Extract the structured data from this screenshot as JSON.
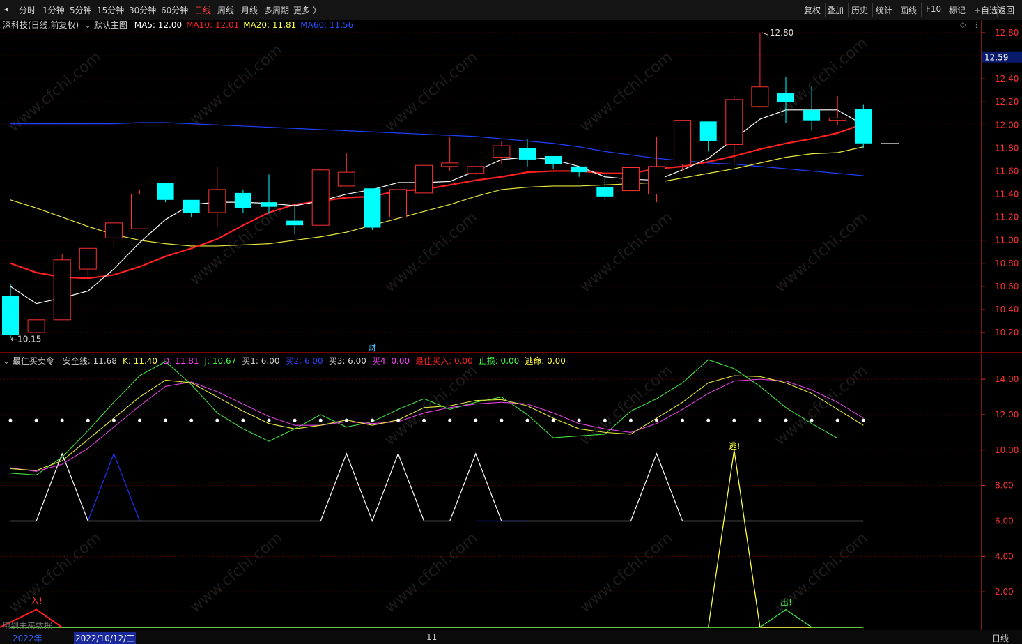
{
  "toolbar": {
    "periods": [
      "分时",
      "1分钟",
      "5分钟",
      "15分钟",
      "30分钟",
      "60分钟",
      "日线",
      "周线",
      "月线",
      "多周期",
      "更多 〉"
    ],
    "active_period": "日线",
    "right_tools": [
      "复权",
      "叠加",
      "历史",
      "统计",
      "画线",
      "F10",
      "标记",
      "+自选",
      "返回"
    ]
  },
  "main_panel": {
    "stock": "深科技(日线,前复权)",
    "template": "默认主图",
    "ma": [
      {
        "label": "MA5: 12.00",
        "color": "#ffffff"
      },
      {
        "label": "MA10: 12.01",
        "color": "#ff2020"
      },
      {
        "label": "MA20: 11.81",
        "color": "#ffff40"
      },
      {
        "label": "MA60: 11.56",
        "color": "#2050ff"
      }
    ],
    "price_axis": [
      "12.80",
      "12.60",
      "12.40",
      "12.20",
      "12.00",
      "11.80",
      "11.60",
      "11.40",
      "11.20",
      "11.00",
      "10.80",
      "10.60",
      "10.40",
      "10.20"
    ],
    "current_price": "12.59",
    "high_label": "12.80",
    "low_label": "10.15",
    "event_marker": "财"
  },
  "sub_panel": {
    "title": "最佳买卖令",
    "values": [
      {
        "label": "安全线: 11.68",
        "color": "#d0d0d0"
      },
      {
        "label": "K: 11.40",
        "color": "#ffff40"
      },
      {
        "label": "D: 11.81",
        "color": "#ff40ff"
      },
      {
        "label": "J: 10.67",
        "color": "#40ff40"
      },
      {
        "label": "买1: 6.00",
        "color": "#d0d0d0"
      },
      {
        "label": "买2: 6.00",
        "color": "#3040ff"
      },
      {
        "label": "买3: 6.00",
        "color": "#d0d0d0"
      },
      {
        "label": "买4: 0.00",
        "color": "#ff40ff"
      },
      {
        "label": "最佳买入: 0.00",
        "color": "#ff2020"
      },
      {
        "label": "止损: 0.00",
        "color": "#40ff40"
      },
      {
        "label": "逃命: 0.00",
        "color": "#ffff40"
      }
    ],
    "axis": [
      "14.00",
      "12.00",
      "10.00",
      "8.00",
      "6.00",
      "4.00",
      "2.00"
    ],
    "signal_in": "入!",
    "signal_escape": "逃!",
    "signal_out": "出!",
    "footnote": "用到未来数据"
  },
  "bottom": {
    "year": "2022年",
    "cursor_date": "2022/10/12/三",
    "month": "11",
    "period": "日线"
  },
  "watermark": "www.cfchi.com",
  "colors": {
    "up": "#ff3030",
    "down": "#00ffff",
    "grid": "#5a0000",
    "axis": "#ff3030"
  },
  "chart_data": {
    "type": "candlestick",
    "price_range": [
      10.1,
      12.9
    ],
    "candles": [
      {
        "o": 10.52,
        "h": 10.62,
        "l": 10.15,
        "c": 10.18
      },
      {
        "o": 10.2,
        "h": 10.32,
        "l": 10.2,
        "c": 10.31
      },
      {
        "o": 10.31,
        "h": 10.88,
        "l": 10.31,
        "c": 10.83
      },
      {
        "o": 10.75,
        "h": 10.93,
        "l": 10.68,
        "c": 10.93
      },
      {
        "o": 11.02,
        "h": 11.16,
        "l": 10.94,
        "c": 11.15
      },
      {
        "o": 11.1,
        "h": 11.44,
        "l": 11.1,
        "c": 11.4
      },
      {
        "o": 11.5,
        "h": 11.5,
        "l": 11.33,
        "c": 11.35
      },
      {
        "o": 11.35,
        "h": 11.35,
        "l": 11.2,
        "c": 11.24
      },
      {
        "o": 11.24,
        "h": 11.64,
        "l": 11.12,
        "c": 11.44
      },
      {
        "o": 11.41,
        "h": 11.44,
        "l": 11.24,
        "c": 11.28
      },
      {
        "o": 11.33,
        "h": 11.57,
        "l": 11.23,
        "c": 11.29
      },
      {
        "o": 11.17,
        "h": 11.32,
        "l": 11.05,
        "c": 11.13
      },
      {
        "o": 11.13,
        "h": 11.62,
        "l": 11.13,
        "c": 11.61
      },
      {
        "o": 11.47,
        "h": 11.76,
        "l": 11.47,
        "c": 11.59
      },
      {
        "o": 11.45,
        "h": 11.45,
        "l": 11.09,
        "c": 11.11
      },
      {
        "o": 11.2,
        "h": 11.62,
        "l": 11.14,
        "c": 11.44
      },
      {
        "o": 11.41,
        "h": 11.66,
        "l": 11.41,
        "c": 11.65
      },
      {
        "o": 11.64,
        "h": 11.9,
        "l": 11.6,
        "c": 11.67
      },
      {
        "o": 11.58,
        "h": 11.64,
        "l": 11.57,
        "c": 11.64
      },
      {
        "o": 11.72,
        "h": 11.86,
        "l": 11.66,
        "c": 11.82
      },
      {
        "o": 11.8,
        "h": 11.88,
        "l": 11.64,
        "c": 11.7
      },
      {
        "o": 11.73,
        "h": 11.73,
        "l": 11.62,
        "c": 11.66
      },
      {
        "o": 11.64,
        "h": 11.64,
        "l": 11.55,
        "c": 11.59
      },
      {
        "o": 11.46,
        "h": 11.58,
        "l": 11.35,
        "c": 11.38
      },
      {
        "o": 11.43,
        "h": 11.63,
        "l": 11.43,
        "c": 11.63
      },
      {
        "o": 11.4,
        "h": 11.9,
        "l": 11.33,
        "c": 11.64
      },
      {
        "o": 11.66,
        "h": 12.04,
        "l": 11.6,
        "c": 12.04
      },
      {
        "o": 12.03,
        "h": 12.03,
        "l": 11.77,
        "c": 11.86
      },
      {
        "o": 11.83,
        "h": 12.25,
        "l": 11.67,
        "c": 12.22
      },
      {
        "o": 12.16,
        "h": 12.8,
        "l": 12.15,
        "c": 12.33
      },
      {
        "o": 12.28,
        "h": 12.42,
        "l": 12.02,
        "c": 12.2
      },
      {
        "o": 12.13,
        "h": 12.34,
        "l": 11.95,
        "c": 12.04
      },
      {
        "o": 12.04,
        "h": 12.25,
        "l": 12.0,
        "c": 12.06
      },
      {
        "o": 12.14,
        "h": 12.18,
        "l": 11.8,
        "c": 11.84
      }
    ],
    "ma5": [
      10.6,
      10.45,
      10.5,
      10.56,
      10.75,
      10.98,
      11.18,
      11.31,
      11.33,
      11.33,
      11.32,
      11.3,
      11.34,
      11.4,
      11.44,
      11.5,
      11.5,
      11.51,
      11.6,
      11.7,
      11.72,
      11.7,
      11.64,
      11.55,
      11.53,
      11.52,
      11.61,
      11.71,
      11.88,
      12.05,
      12.13,
      12.13,
      12.13,
      12.0
    ],
    "ma10": [
      10.8,
      10.72,
      10.68,
      10.67,
      10.7,
      10.77,
      10.86,
      10.93,
      11.01,
      11.13,
      11.24,
      11.31,
      11.34,
      11.37,
      11.38,
      11.43,
      11.44,
      11.48,
      11.52,
      11.55,
      11.59,
      11.6,
      11.6,
      11.58,
      11.58,
      11.62,
      11.64,
      11.68,
      11.73,
      11.79,
      11.84,
      11.88,
      11.93,
      12.01
    ],
    "ma20": [
      11.35,
      11.28,
      11.2,
      11.12,
      11.05,
      11.0,
      10.97,
      10.95,
      10.95,
      10.96,
      10.97,
      11.0,
      11.03,
      11.07,
      11.13,
      11.19,
      11.25,
      11.31,
      11.38,
      11.44,
      11.46,
      11.47,
      11.47,
      11.48,
      11.49,
      11.5,
      11.54,
      11.58,
      11.62,
      11.67,
      11.72,
      11.75,
      11.76,
      11.81
    ],
    "ma60": [
      12.01,
      12.01,
      12.01,
      12.01,
      12.01,
      12.02,
      12.02,
      12.01,
      12.0,
      11.99,
      11.98,
      11.97,
      11.96,
      11.95,
      11.94,
      11.93,
      11.92,
      11.91,
      11.9,
      11.88,
      11.86,
      11.84,
      11.81,
      11.77,
      11.74,
      11.71,
      11.69,
      11.67,
      11.66,
      11.64,
      11.62,
      11.6,
      11.58,
      11.56
    ],
    "sub_range": [
      0,
      15.5
    ],
    "safety_line": 11.68,
    "k": [
      8.95,
      8.85,
      9.4,
      10.6,
      11.8,
      13.0,
      13.95,
      13.8,
      13.0,
      12.2,
      11.5,
      11.2,
      11.4,
      11.7,
      11.4,
      11.7,
      12.4,
      12.5,
      12.8,
      12.85,
      12.5,
      11.8,
      11.2,
      11.0,
      10.9,
      11.8,
      12.7,
      13.8,
      14.2,
      14.15,
      13.8,
      13.2,
      12.3,
      11.4
    ],
    "d": [
      9.0,
      8.8,
      9.2,
      10.1,
      11.3,
      12.5,
      13.6,
      13.85,
      13.3,
      12.6,
      11.9,
      11.4,
      11.4,
      11.6,
      11.5,
      11.6,
      12.1,
      12.4,
      12.6,
      12.7,
      12.6,
      12.1,
      11.5,
      11.2,
      11.0,
      11.5,
      12.3,
      13.2,
      13.9,
      14.0,
      13.9,
      13.4,
      12.7,
      11.81
    ],
    "j": [
      8.7,
      8.6,
      9.6,
      11.1,
      12.7,
      14.2,
      15.0,
      13.7,
      12.1,
      11.2,
      10.5,
      11.2,
      12.0,
      11.3,
      11.6,
      12.3,
      12.9,
      12.3,
      12.7,
      13.0,
      12.0,
      10.7,
      10.8,
      10.9,
      12.2,
      12.9,
      13.8,
      15.1,
      14.6,
      13.6,
      12.4,
      11.5,
      10.67
    ],
    "buy1": [
      6,
      6,
      9.8,
      6,
      6,
      6,
      6,
      6,
      6,
      6,
      6,
      6,
      6,
      9.8,
      6,
      9.8,
      6,
      6,
      9.8,
      6,
      6,
      6,
      6,
      6,
      6,
      9.8,
      6,
      6,
      6,
      6,
      6,
      6,
      6,
      6
    ],
    "buy2": [
      6,
      6,
      6,
      6,
      9.8,
      6,
      6,
      6,
      6,
      6,
      6,
      6,
      6,
      6,
      6,
      6,
      6,
      6,
      6,
      6,
      6,
      6,
      6,
      6,
      6,
      6,
      6,
      6,
      6,
      6,
      6,
      6,
      6,
      6
    ],
    "escape": [
      0,
      0,
      0,
      0,
      0,
      0,
      0,
      0,
      0,
      0,
      0,
      0,
      0,
      0,
      0,
      0,
      0,
      0,
      0,
      0,
      0,
      0,
      0,
      0,
      0,
      0,
      0,
      0,
      10,
      0,
      0,
      0,
      0,
      0
    ],
    "stop": [
      0,
      0,
      0,
      0,
      0,
      0,
      0,
      0,
      0,
      0,
      0,
      0,
      0,
      0,
      0,
      0,
      0,
      0,
      0,
      0,
      0,
      0,
      0,
      0,
      0,
      0,
      0,
      0,
      0,
      0,
      1,
      0,
      0,
      0
    ],
    "best_buy": [
      1,
      0,
      0,
      0,
      0,
      0,
      0,
      0,
      0,
      0,
      0,
      0,
      0,
      0,
      0,
      0,
      0,
      0,
      0,
      0,
      0,
      0,
      0,
      0,
      0,
      0,
      0,
      0,
      0,
      0,
      0,
      0,
      0,
      0
    ]
  }
}
